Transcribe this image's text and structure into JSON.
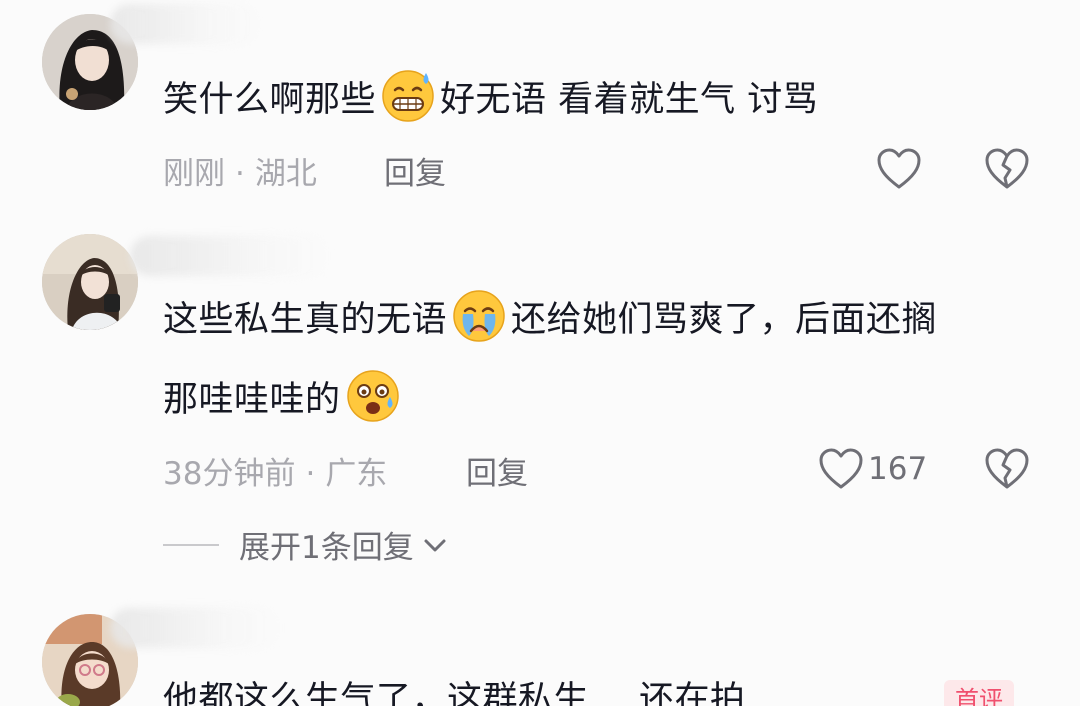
{
  "comments": [
    {
      "text_a": "笑什么啊那些",
      "text_b": "好无语 看着就生气 讨骂",
      "emoji": "grimacing-sweat-emoji",
      "time": "刚刚",
      "location": "湖北",
      "reply_label": "回复"
    },
    {
      "line1_a": "这些私生真的无语",
      "line1_b": "还给她们骂爽了，后面还搁",
      "line2": "那哇哇哇的",
      "emoji1": "crying-emoji",
      "emoji2": "shocked-sweat-emoji",
      "time": "38分钟前",
      "location": "广东",
      "reply_label": "回复",
      "like_count": "167",
      "expand_label": "展开1条回复"
    },
    {
      "text_a": "他都这么生气了，这群私生",
      "text_b": "还在拍",
      "badge": "首评"
    }
  ],
  "separator": "·",
  "colors": {
    "text": "#161823",
    "meta": "#a8a8ae",
    "action": "#6f6f76",
    "badge": "#f0506e"
  }
}
